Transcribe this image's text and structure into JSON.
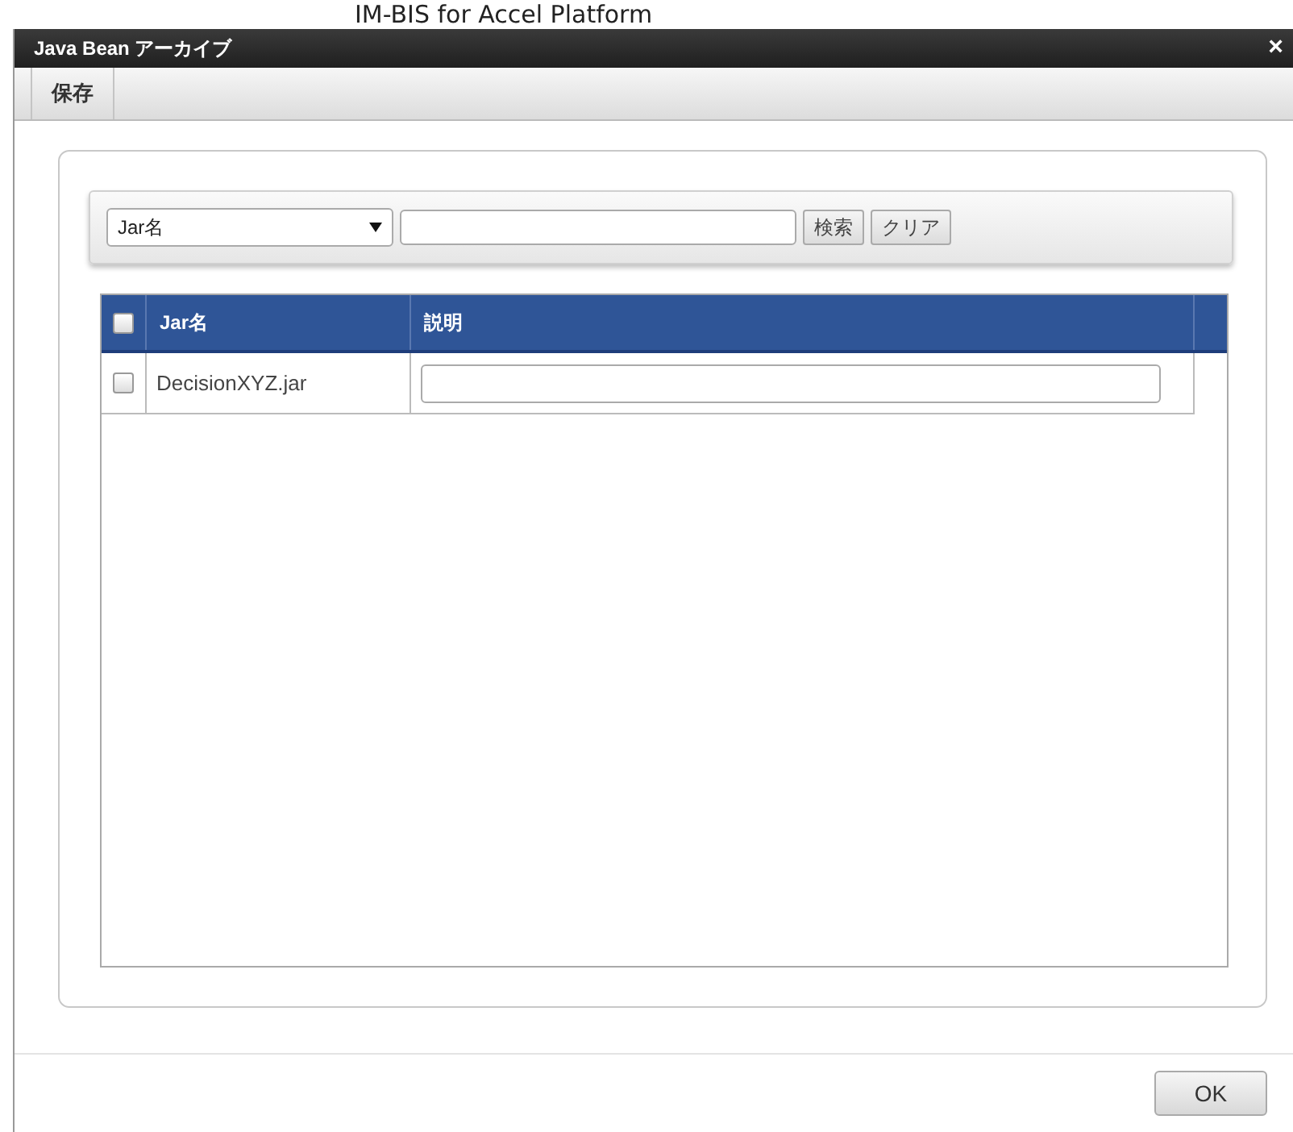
{
  "background_heading": "IM-BIS for Accel Platform",
  "dialog": {
    "title": "Java Bean アーカイブ",
    "close": "×"
  },
  "toolbar": {
    "buttons": [
      {
        "label": "保存"
      }
    ]
  },
  "search": {
    "field_select": "Jar名",
    "buttons": [
      {
        "label": "検索"
      },
      {
        "label": "クリア"
      }
    ]
  },
  "table": {
    "select_all_checked": false,
    "columns": [
      "Jar名",
      "説明"
    ],
    "rows": [
      {
        "checked": false,
        "name": "DecisionXYZ.jar"
      }
    ]
  },
  "footer": {
    "buttons": [
      {
        "label": "OK"
      }
    ]
  }
}
